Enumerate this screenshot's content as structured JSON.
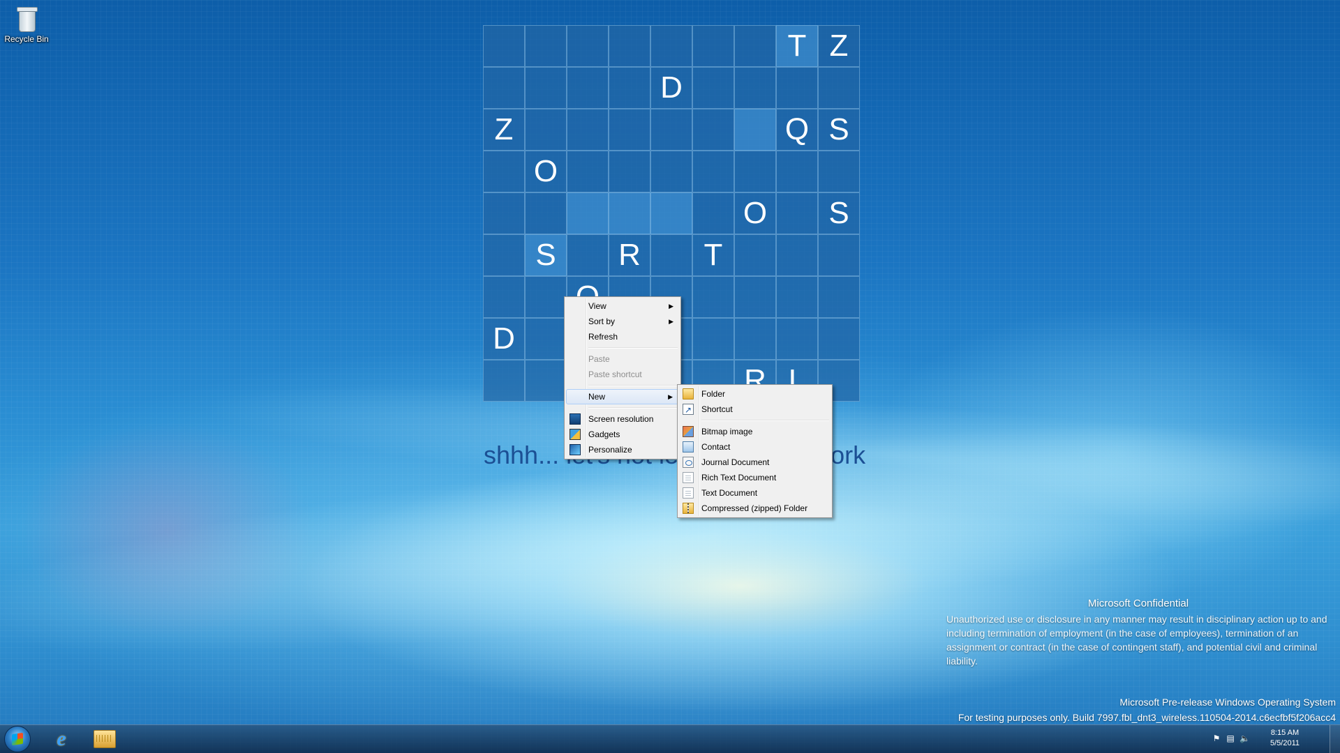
{
  "desktop": {
    "icons": [
      {
        "label": "Recycle Bin",
        "icon": "recycle-bin-icon"
      }
    ]
  },
  "board": {
    "rows": [
      [
        "",
        "",
        "",
        "",
        "",
        "",
        "",
        "T",
        "Z"
      ],
      [
        "",
        "",
        "",
        "",
        "D",
        "",
        "",
        "",
        ""
      ],
      [
        "Z",
        "",
        "",
        "",
        "",
        "",
        "",
        "Q",
        "S"
      ],
      [
        "",
        "O",
        "",
        "",
        "",
        "",
        "",
        "",
        ""
      ],
      [
        "",
        "",
        "",
        "",
        "",
        "",
        "O",
        "",
        "S"
      ],
      [
        "",
        "S",
        "",
        "R",
        "",
        "T",
        "",
        "",
        ""
      ],
      [
        "",
        "",
        "O",
        "",
        "",
        "",
        "",
        "",
        ""
      ],
      [
        "D",
        "",
        "",
        "",
        "",
        "",
        "",
        "",
        ""
      ],
      [
        "",
        "",
        "",
        "",
        "",
        "",
        "R",
        "L",
        ""
      ]
    ],
    "caption": "shhh... let's not leak our hard work"
  },
  "context_menu": {
    "items": [
      {
        "label": "View",
        "submenu": true
      },
      {
        "label": "Sort by",
        "submenu": true
      },
      {
        "label": "Refresh"
      },
      {
        "separator": true
      },
      {
        "label": "Paste",
        "disabled": true
      },
      {
        "label": "Paste shortcut",
        "disabled": true
      },
      {
        "separator": true
      },
      {
        "label": "New",
        "submenu": true,
        "active": true
      },
      {
        "separator": true
      },
      {
        "label": "Screen resolution",
        "icon": "screen-resolution-icon"
      },
      {
        "label": "Gadgets",
        "icon": "gadgets-icon"
      },
      {
        "label": "Personalize",
        "icon": "personalize-icon"
      }
    ]
  },
  "new_submenu": {
    "items": [
      {
        "label": "Folder",
        "icon": "folder-icon"
      },
      {
        "label": "Shortcut",
        "icon": "shortcut-icon"
      },
      {
        "separator": true
      },
      {
        "label": "Bitmap image",
        "icon": "bitmap-image-icon"
      },
      {
        "label": "Contact",
        "icon": "contact-icon"
      },
      {
        "label": "Journal Document",
        "icon": "journal-document-icon"
      },
      {
        "label": "Rich Text Document",
        "icon": "rich-text-document-icon"
      },
      {
        "label": "Text Document",
        "icon": "text-document-icon"
      },
      {
        "label": "Compressed (zipped) Folder",
        "icon": "zip-folder-icon"
      }
    ]
  },
  "watermark": {
    "title": "Microsoft Confidential",
    "body": "Unauthorized use or disclosure in any manner may result in disciplinary action up to and including termination of employment (in the case of employees), termination of an assignment or contract (in the case of contingent staff), and potential civil and criminal liability.",
    "os_line": "Microsoft Pre-release Windows Operating System",
    "build_line": "For testing purposes only. Build 7997.fbl_dnt3_wireless.110504-2014.c6ecfbf5f206acc4"
  },
  "taskbar": {
    "start_icon": "windows-start-icon",
    "pinned": [
      {
        "name": "Internet Explorer",
        "icon": "internet-explorer-icon"
      },
      {
        "name": "Windows Explorer",
        "icon": "windows-explorer-icon"
      }
    ],
    "tray_icons": [
      "action-center-flag-icon",
      "network-icon",
      "volume-icon"
    ],
    "clock": {
      "time": "8:15 AM",
      "date": "5/5/2011"
    }
  }
}
